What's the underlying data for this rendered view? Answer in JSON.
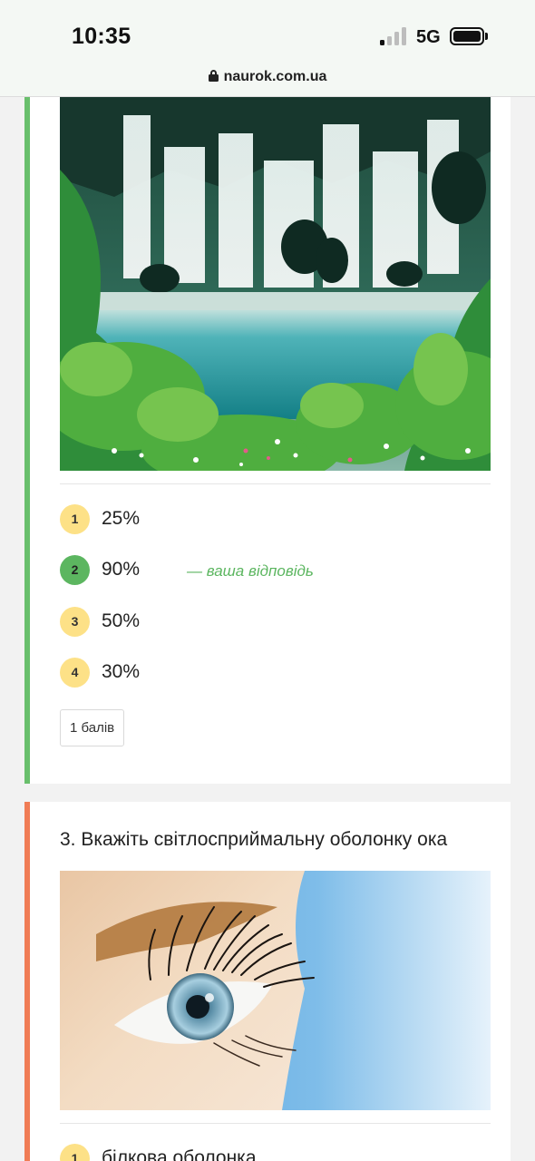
{
  "status_bar": {
    "time": "10:35",
    "network": "5G",
    "signal_bars_active": 1,
    "url": "naurok.com.ua"
  },
  "quiz": {
    "question2": {
      "image_icon": "waterfall-photo",
      "answers": [
        {
          "number": "1",
          "text": "25%"
        },
        {
          "number": "2",
          "text": "90%",
          "note": "— ваша відповідь"
        },
        {
          "number": "3",
          "text": "50%"
        },
        {
          "number": "4",
          "text": "30%"
        }
      ],
      "points": "1 балів"
    },
    "question3": {
      "title": "3. Вкажіть світлосприймальну оболонку ока",
      "image_icon": "eye-photo",
      "answers": [
        {
          "number": "1",
          "text": "білкова оболонка"
        }
      ]
    }
  },
  "colors": {
    "correct": "#5cb660",
    "neutral_badge": "#fde187",
    "correct_border": "#69bf6c",
    "pending_border": "#f07c55"
  }
}
